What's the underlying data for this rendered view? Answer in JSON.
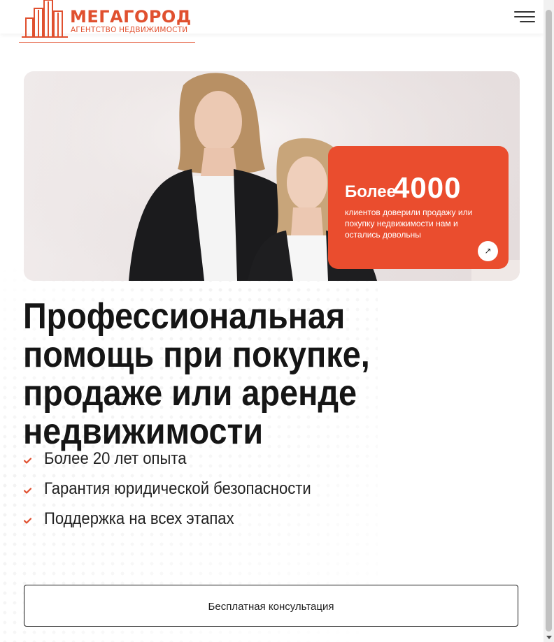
{
  "brand": {
    "name": "МЕГАГОРОД",
    "subtitle": "АГЕНТСТВО НЕДВИЖИМОСТИ",
    "accent_color": "#ea4d2e"
  },
  "header": {
    "menu_icon": "hamburger-menu-icon"
  },
  "hero": {
    "stat_prefix": "Более",
    "stat_number": "4000",
    "stat_text": "клиентов доверили продажу или покупку недвижимости нам и остались довольны",
    "stat_arrow_icon": "arrow-up-right-icon",
    "stat_arrow_glyph": "↗"
  },
  "headline": "Профессиональная помощь при покупке, продаже или аренде недвижимости",
  "features": [
    {
      "text": "Более 20 лет опыта",
      "icon": "check-icon"
    },
    {
      "text": "Гарантия юридической безопасности",
      "icon": "check-icon"
    },
    {
      "text": "Поддержка на всех этапах",
      "icon": "check-icon"
    }
  ],
  "cta": {
    "label": "Бесплатная консультация"
  }
}
